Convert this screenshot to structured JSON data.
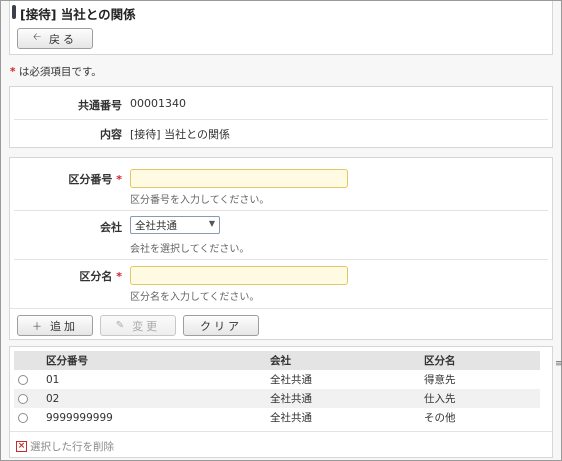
{
  "header": {
    "title": "[接待] 当社との関係",
    "back_label": "戻る",
    "back_icon": "arrow-left-icon"
  },
  "required_note": {
    "mark": "*",
    "text": "は必須項目です。"
  },
  "info": {
    "common_number_label": "共通番号",
    "common_number_value": "00001340",
    "content_label": "内容",
    "content_value": "[接待] 当社との関係"
  },
  "form": {
    "division_number_label": "区分番号",
    "division_number_value": "",
    "division_number_hint": "区分番号を入力してください。",
    "company_label": "会社",
    "company_selected": "全社共通",
    "company_hint": "会社を選択してください。",
    "division_name_label": "区分名",
    "division_name_value": "",
    "division_name_hint": "区分名を入力してください。",
    "required_mark": "*",
    "required_color": "#d3232b",
    "input_bg_color": "#fffbe3"
  },
  "actions": {
    "add_label": "追加",
    "add_icon": "plus-icon",
    "change_label": "変更",
    "change_icon": "pencil-icon",
    "clear_label": "クリア"
  },
  "table": {
    "columns": [
      "区分番号",
      "会社",
      "区分名"
    ],
    "rows": [
      {
        "number": "01",
        "company": "全社共通",
        "name": "得意先"
      },
      {
        "number": "02",
        "company": "全社共通",
        "name": "仕入先"
      },
      {
        "number": "9999999999",
        "company": "全社共通",
        "name": "その他"
      }
    ],
    "delete_label": "選択した行を削除",
    "delete_icon": "delete-x-icon"
  }
}
